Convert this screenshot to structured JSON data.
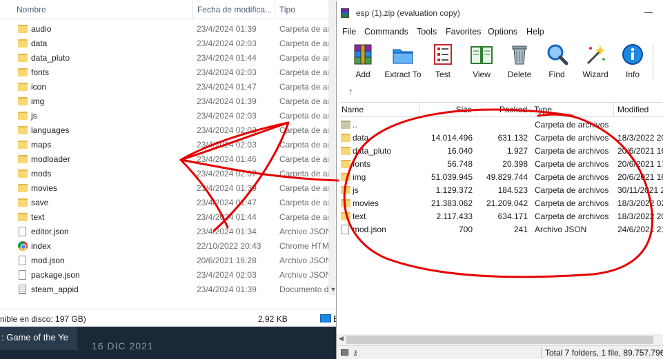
{
  "explorer": {
    "columns": {
      "name": "Nombre",
      "date": "Fecha de modifica...",
      "type": "Tipo"
    },
    "rows": [
      {
        "name": "audio",
        "date": "23/4/2024 01:39",
        "type": "Carpeta de archivos",
        "icon": "folder-icon"
      },
      {
        "name": "data",
        "date": "23/4/2024 02:03",
        "type": "Carpeta de archivos",
        "icon": "folder-icon"
      },
      {
        "name": "data_pluto",
        "date": "23/4/2024 01:44",
        "type": "Carpeta de archivos",
        "icon": "folder-icon"
      },
      {
        "name": "fonts",
        "date": "23/4/2024 02:03",
        "type": "Carpeta de archivos",
        "icon": "folder-icon"
      },
      {
        "name": "icon",
        "date": "23/4/2024 01:47",
        "type": "Carpeta de archivos",
        "icon": "folder-icon"
      },
      {
        "name": "img",
        "date": "23/4/2024 01:39",
        "type": "Carpeta de archivos",
        "icon": "folder-icon"
      },
      {
        "name": "js",
        "date": "23/4/2024 02:03",
        "type": "Carpeta de archivos",
        "icon": "folder-icon"
      },
      {
        "name": "languages",
        "date": "23/4/2024 02:03",
        "type": "Carpeta de archivos",
        "icon": "folder-icon"
      },
      {
        "name": "maps",
        "date": "23/4/2024 02:03",
        "type": "Carpeta de archivos",
        "icon": "folder-icon"
      },
      {
        "name": "modloader",
        "date": "23/4/2024 01:46",
        "type": "Carpeta de archivos",
        "icon": "folder-icon"
      },
      {
        "name": "mods",
        "date": "23/4/2024 02:07",
        "type": "Carpeta de archivos",
        "icon": "folder-icon"
      },
      {
        "name": "movies",
        "date": "23/4/2024 01:39",
        "type": "Carpeta de archivos",
        "icon": "folder-icon"
      },
      {
        "name": "save",
        "date": "23/4/2024 01:47",
        "type": "Carpeta de archivos",
        "icon": "folder-icon"
      },
      {
        "name": "text",
        "date": "23/4/2024 01:44",
        "type": "Carpeta de archivos",
        "icon": "folder-icon"
      },
      {
        "name": "editor.json",
        "date": "23/4/2024 01:34",
        "type": "Archivo JSON",
        "icon": "file-icon"
      },
      {
        "name": "index",
        "date": "22/10/2022 20:43",
        "type": "Chrome HTML",
        "icon": "chrome-icon"
      },
      {
        "name": "mod.json",
        "date": "20/6/2021 16:28",
        "type": "Archivo JSON",
        "icon": "file-icon"
      },
      {
        "name": "package.json",
        "date": "23/4/2024 02:03",
        "type": "Archivo JSON",
        "icon": "file-icon"
      },
      {
        "name": "steam_appid",
        "date": "23/4/2024 01:39",
        "type": "Documento de texto",
        "icon": "text-file-icon"
      }
    ],
    "status": {
      "free_space": "nible en disco: 197 GB)",
      "size": "2,92 KB",
      "location": "E"
    }
  },
  "taskbar": {
    "game_button": ": Game of the Ye",
    "date": "16 DIC 2021"
  },
  "winrar": {
    "title": "esp (1).zip (evaluation copy)",
    "menu": [
      "File",
      "Commands",
      "Tools",
      "Favorites",
      "Options",
      "Help"
    ],
    "toolbar": [
      {
        "label": "Add",
        "icon": "add-archive-icon"
      },
      {
        "label": "Extract To",
        "icon": "extract-folder-icon"
      },
      {
        "label": "Test",
        "icon": "test-checklist-icon"
      },
      {
        "label": "View",
        "icon": "view-book-icon"
      },
      {
        "label": "Delete",
        "icon": "trash-icon"
      },
      {
        "label": "Find",
        "icon": "magnifier-icon"
      },
      {
        "label": "Wizard",
        "icon": "wizard-wand-icon"
      },
      {
        "label": "Info",
        "icon": "info-icon"
      }
    ],
    "columns": {
      "name": "Name",
      "size": "Size",
      "packed": "Packed",
      "type": "Type",
      "modified": "Modified"
    },
    "rows": [
      {
        "name": "..",
        "size": "",
        "packed": "",
        "type": "Carpeta de archivos",
        "modified": "",
        "icon": "up-folder-icon"
      },
      {
        "name": "data",
        "size": "14.014.496",
        "packed": "631.132",
        "type": "Carpeta de archivos",
        "modified": "18/3/2022 20:",
        "icon": "folder-icon"
      },
      {
        "name": "data_pluto",
        "size": "16.040",
        "packed": "1.927",
        "type": "Carpeta de archivos",
        "modified": "20/6/2021 16:",
        "icon": "folder-icon"
      },
      {
        "name": "fonts",
        "size": "56.748",
        "packed": "20.398",
        "type": "Carpeta de archivos",
        "modified": "20/6/2021 17:",
        "icon": "folder-icon"
      },
      {
        "name": "img",
        "size": "51.039.945",
        "packed": "49.829.744",
        "type": "Carpeta de archivos",
        "modified": "20/6/2021 16:",
        "icon": "folder-icon"
      },
      {
        "name": "js",
        "size": "1.129.372",
        "packed": "184.523",
        "type": "Carpeta de archivos",
        "modified": "30/11/2021 2",
        "icon": "folder-icon"
      },
      {
        "name": "movies",
        "size": "21.383.062",
        "packed": "21.209.042",
        "type": "Carpeta de archivos",
        "modified": "18/3/2022 02:",
        "icon": "folder-icon"
      },
      {
        "name": "text",
        "size": "2.117.433",
        "packed": "634.171",
        "type": "Carpeta de archivos",
        "modified": "18/3/2022 20:",
        "icon": "folder-icon"
      },
      {
        "name": "mod.json",
        "size": "700",
        "packed": "241",
        "type": "Archivo JSON",
        "modified": "24/6/2021 21:",
        "icon": "file-icon"
      }
    ],
    "status": {
      "total": "Total 7 folders, 1 file, 89.757.796 b"
    }
  },
  "annotation_color": "#e60000"
}
